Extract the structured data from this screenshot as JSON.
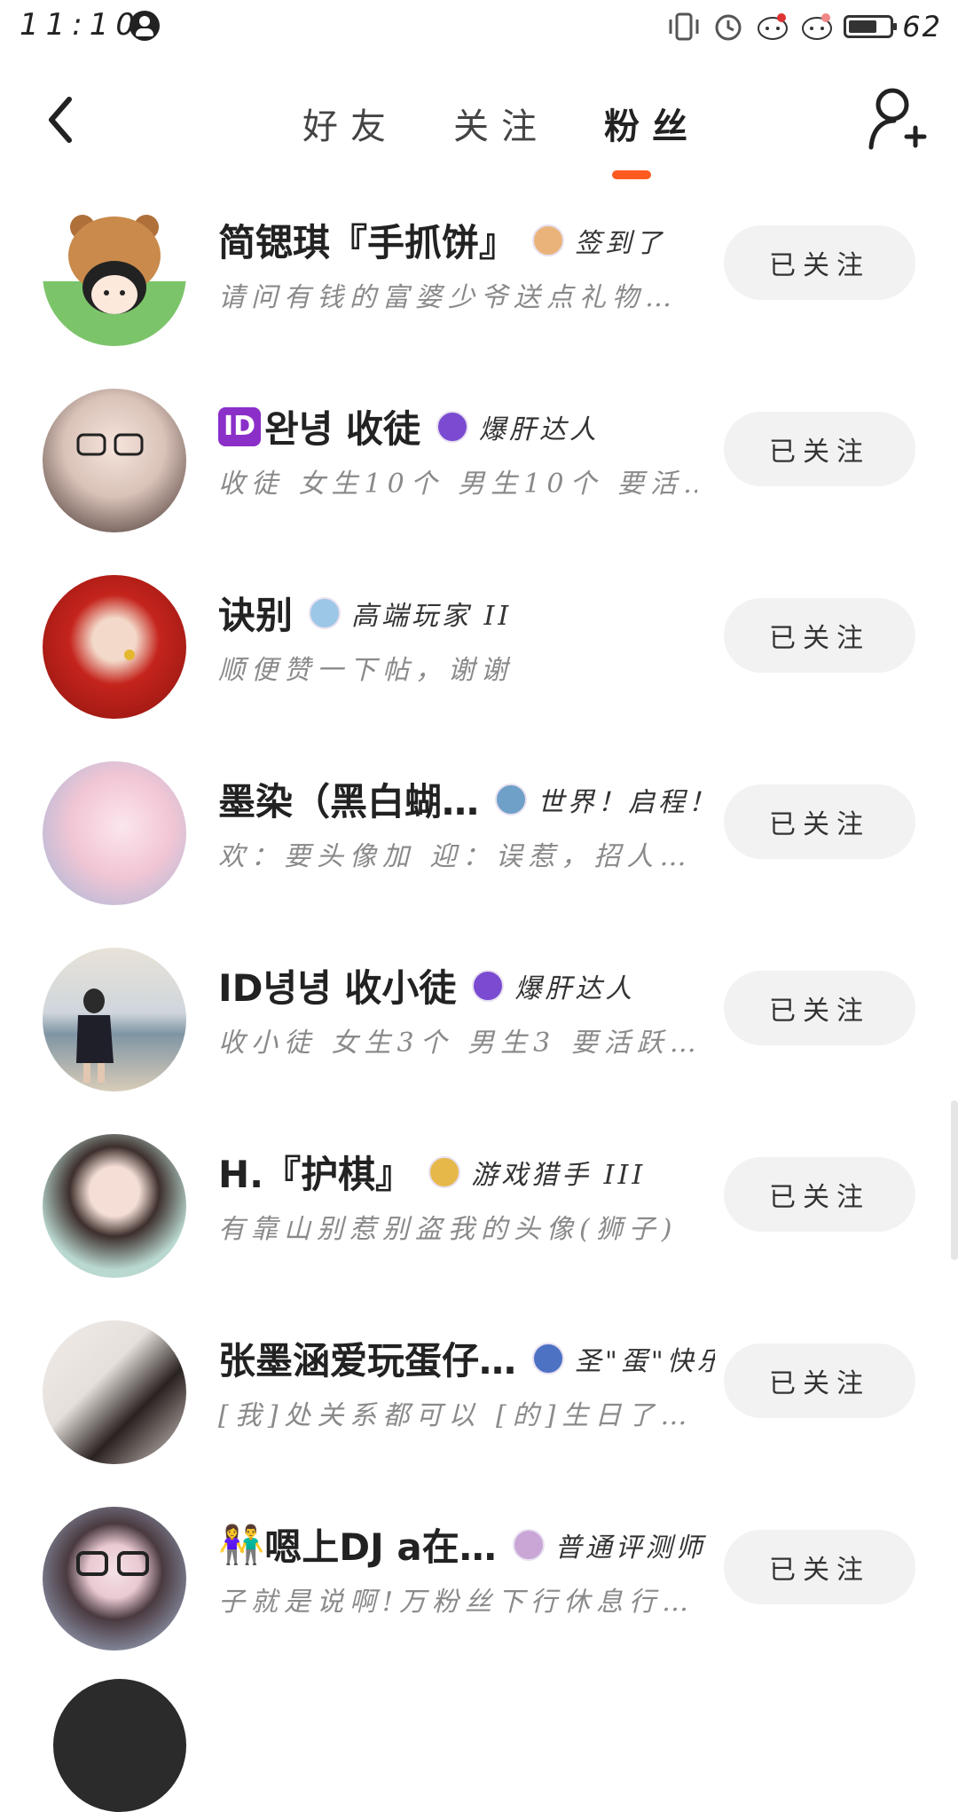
{
  "status_bar": {
    "time": "11:10",
    "battery_level": "62"
  },
  "header": {
    "tabs": [
      {
        "label": "好友",
        "active": false
      },
      {
        "label": "关注",
        "active": false
      },
      {
        "label": "粉丝",
        "active": true
      }
    ]
  },
  "fans": [
    {
      "name": "简锶琪『手抓饼』",
      "id_badge": "",
      "title": "签到了",
      "bio": "请问有钱的富婆少爷送点礼物…",
      "button": "已关注",
      "avatar_color": "#7cc46a",
      "medal_color": "#e9b37a"
    },
    {
      "name": "완녕 收徒",
      "id_badge": "ID",
      "title": "爆肝达人",
      "bio": "收徒 女生10个 男生10个 要活…",
      "button": "已关注",
      "avatar_color": "#d9c2b8",
      "medal_color": "#7a4bd1"
    },
    {
      "name": "诀别",
      "id_badge": "",
      "title": "高端玩家 II",
      "bio": "顺便赞一下帖，谢谢",
      "button": "已关注",
      "avatar_color": "#c4241c",
      "medal_color": "#9cc7e6"
    },
    {
      "name": "墨染（黑白蝴…",
      "id_badge": "",
      "title": "世界！启程！",
      "bio": "欢：要头像加 迎：误惹，招人…",
      "button": "已关注",
      "avatar_color": "#f2c6d4",
      "medal_color": "#6fa0c8"
    },
    {
      "name": "ID녕녕 收小徒",
      "id_badge": "",
      "title": "爆肝达人",
      "bio": "收小徒 女生3个 男生3 要活跃…",
      "button": "已关注",
      "avatar_color": "#a9b8c4",
      "medal_color": "#7a4bd1"
    },
    {
      "name": "H.『护棋』",
      "id_badge": "",
      "title": "游戏猎手 III",
      "bio": "有靠山别惹别盗我的头像(狮子)",
      "button": "已关注",
      "avatar_color": "#b9d8d0",
      "medal_color": "#e6b84a"
    },
    {
      "name": "张墨涵爱玩蛋仔…",
      "id_badge": "",
      "title": "圣\"蛋\"快乐",
      "bio": "[我]处关系都可以 [的]生日了…",
      "button": "已关注",
      "avatar_color": "#e6e0dc",
      "medal_color": "#4d72c4"
    },
    {
      "name": "嗯上DJ a在…",
      "id_badge": "👫",
      "title": "普通评测师",
      "bio": "子就是说啊!万粉丝下行休息行…",
      "button": "已关注",
      "avatar_color": "#8c93a8",
      "medal_color": "#c9a6d6"
    }
  ]
}
